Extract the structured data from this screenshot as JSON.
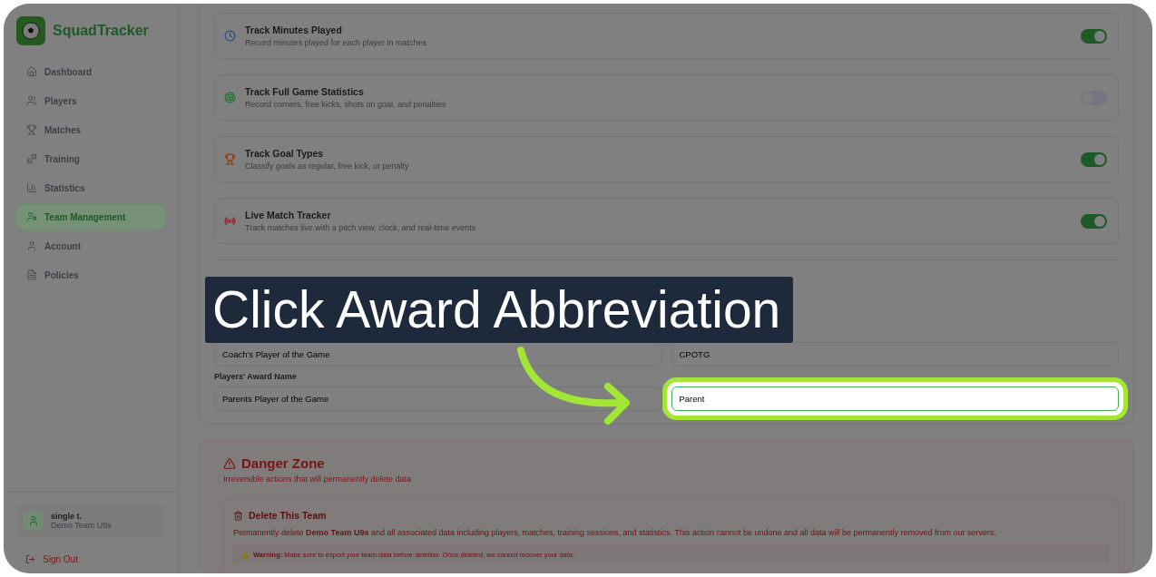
{
  "sidebar": {
    "brand": "SquadTracker",
    "items": [
      {
        "label": "Dashboard",
        "selected": false
      },
      {
        "label": "Players",
        "selected": false
      },
      {
        "label": "Matches",
        "selected": false
      },
      {
        "label": "Training",
        "selected": false
      },
      {
        "label": "Statistics",
        "selected": false
      },
      {
        "label": "Team Management",
        "selected": true
      },
      {
        "label": "Account",
        "selected": false
      },
      {
        "label": "Policies",
        "selected": false
      }
    ],
    "user": {
      "name": "single t.",
      "team": "Demo Team U9s"
    },
    "sign_out": "Sign Out"
  },
  "features": [
    {
      "title": "Track Minutes Played",
      "description": "Record minutes played for each player in matches",
      "on": true
    },
    {
      "title": "Track Full Game Statistics",
      "description": "Record corners, free kicks, shots on goal, and penalties",
      "on": false
    },
    {
      "title": "Track Goal Types",
      "description": "Classify goals as regular, free kick, or penalty",
      "on": true
    },
    {
      "title": "Live Match Tracker",
      "description": "Track matches live with a pitch view, clock, and real-time events",
      "on": true
    }
  ],
  "awards": [
    {
      "value": "Coach's Player of the Game",
      "highlighted": false
    },
    {
      "value": "CPOTG",
      "highlighted": false
    },
    {
      "label": "Players' Award Name",
      "value": "Parents Player of the Game",
      "highlighted": false
    },
    {
      "value": "Parent",
      "highlighted": true
    }
  ],
  "danger_zone": {
    "title": "Danger Zone",
    "subtitle": "Irreversible actions that will permanently delete data",
    "delete": {
      "title": "Delete This Team",
      "text": "Permanently delete **Demo Team U9s** and all associated data including players, matches, training sessions, and statistics. This action cannot be undone and all data will be permanently removed from our servers.",
      "warning": "**Warning:** Make sure to export your team data before deletion. Once deleted, we cannot recover your data."
    }
  },
  "callout": {
    "text": "Click Award Abbreviation"
  }
}
